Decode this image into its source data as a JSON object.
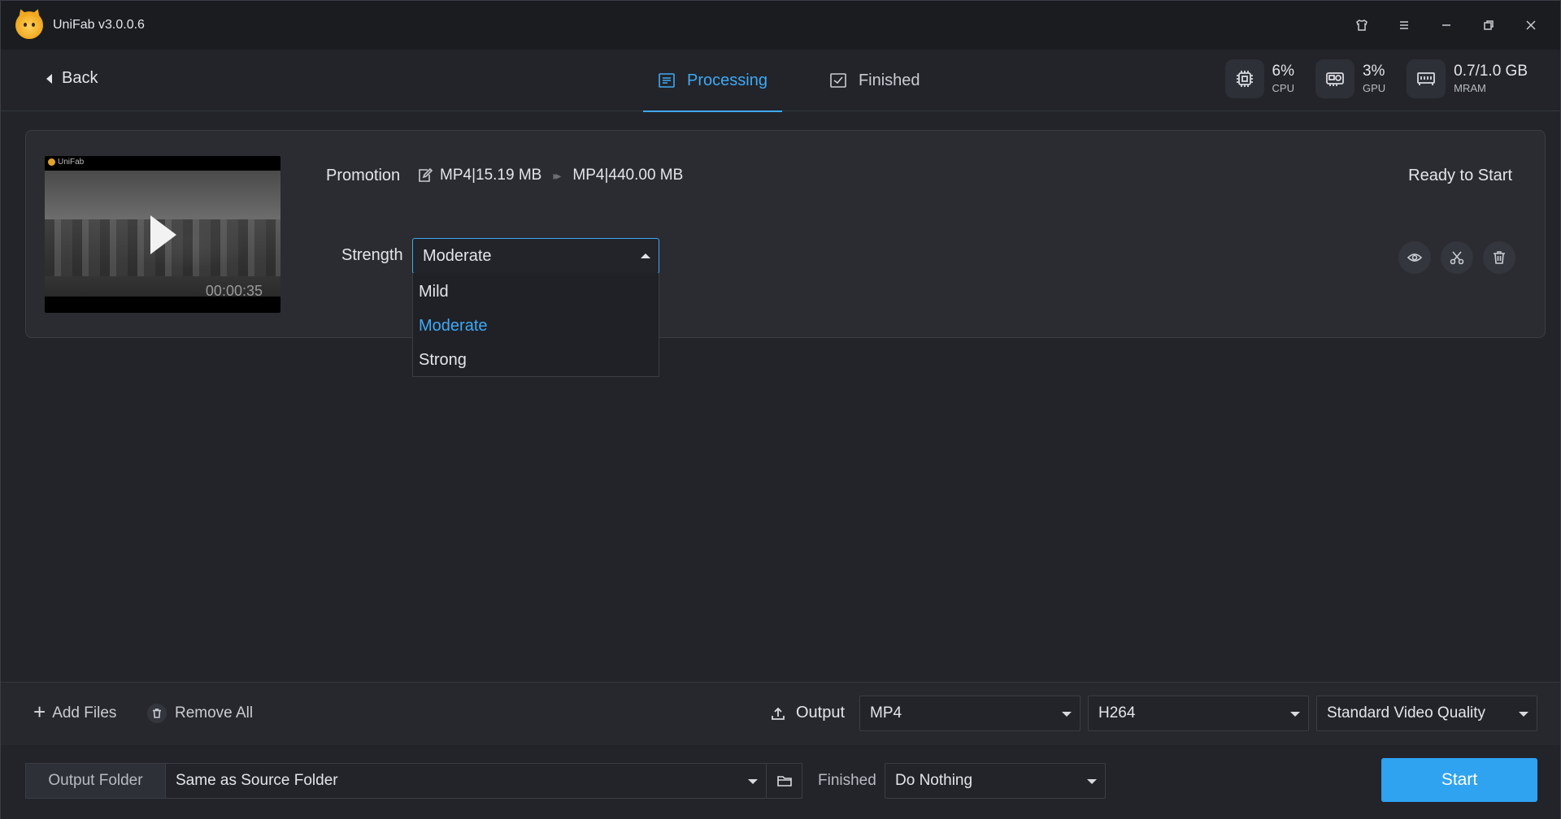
{
  "app": {
    "title": "UniFab v3.0.0.6",
    "window_controls": [
      "shirt-icon",
      "menu-icon",
      "minimize-icon",
      "restore-icon",
      "close-icon"
    ]
  },
  "nav": {
    "back_label": "Back",
    "tabs": [
      {
        "label": "Processing",
        "icon": "list-icon",
        "active": true
      },
      {
        "label": "Finished",
        "icon": "checkbox-icon",
        "active": false
      }
    ],
    "stats": [
      {
        "value": "6%",
        "label": "CPU",
        "icon": "cpu-icon"
      },
      {
        "value": "3%",
        "label": "GPU",
        "icon": "gpu-icon"
      },
      {
        "value": "0.7/1.0 GB",
        "label": "MRAM",
        "icon": "memory-icon"
      }
    ]
  },
  "task": {
    "thumbnail_brand": "UniFab",
    "duration": "00:00:35",
    "name": "Promotion",
    "source_format": "MP4|15.19 MB",
    "output_format": "MP4|440.00 MB",
    "status": "Ready to Start",
    "strength_label": "Strength",
    "strength_value": "Moderate",
    "strength_options": [
      {
        "label": "Mild",
        "selected": false
      },
      {
        "label": "Moderate",
        "selected": true
      },
      {
        "label": "Strong",
        "selected": false
      }
    ],
    "actions": [
      "preview-icon",
      "trim-icon",
      "delete-icon"
    ]
  },
  "toolbar": {
    "add_files": "Add Files",
    "remove_all": "Remove All",
    "output_label": "Output",
    "format": "MP4",
    "codec": "H264",
    "quality": "Standard Video Quality"
  },
  "footer": {
    "output_folder_label": "Output Folder",
    "output_folder_value": "Same as Source Folder",
    "finished_label": "Finished",
    "finished_action": "Do Nothing",
    "start_label": "Start"
  },
  "colors": {
    "accent": "#3fa9f5",
    "start_button": "#2fa3f0",
    "background": "#222429"
  }
}
